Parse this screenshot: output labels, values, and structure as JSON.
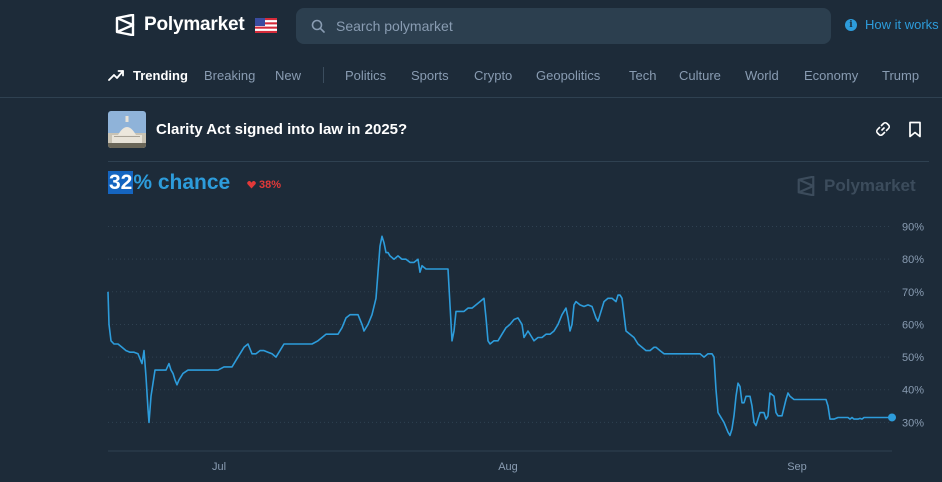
{
  "header": {
    "logo_text": "Polymarket",
    "flag_icon": "us-flag-icon",
    "search_placeholder": "Search polymarket",
    "how_it_works": "How it works",
    "accent": "#2d9cdb"
  },
  "nav": {
    "items": [
      {
        "label": "Trending",
        "active": true
      },
      {
        "label": "Breaking"
      },
      {
        "label": "New"
      },
      {
        "label": "Politics"
      },
      {
        "label": "Sports"
      },
      {
        "label": "Crypto"
      },
      {
        "label": "Geopolitics"
      },
      {
        "label": "Tech"
      },
      {
        "label": "Culture"
      },
      {
        "label": "World"
      },
      {
        "label": "Economy"
      },
      {
        "label": "Trump"
      }
    ]
  },
  "market": {
    "title": "Clarity Act signed into law in 2025?",
    "chance_value": "32",
    "chance_suffix": "% chance",
    "change": "38%",
    "change_direction": "down",
    "change_color": "#e23939",
    "watermark": "Polymarket"
  },
  "chart_data": {
    "type": "line",
    "series": [
      {
        "color": "#2d9cdb",
        "points": [
          [
            0,
            70
          ],
          [
            1,
            60
          ],
          [
            3,
            55
          ],
          [
            6,
            54
          ],
          [
            10,
            54
          ],
          [
            14,
            53
          ],
          [
            18,
            52
          ],
          [
            22,
            51.5
          ],
          [
            26,
            51.5
          ],
          [
            30,
            51
          ],
          [
            34,
            48
          ],
          [
            36,
            52
          ],
          [
            38,
            44
          ],
          [
            40,
            34
          ],
          [
            41,
            30
          ],
          [
            43,
            38
          ],
          [
            47,
            46
          ],
          [
            51,
            46
          ],
          [
            54,
            46
          ],
          [
            58,
            46
          ],
          [
            61,
            48
          ],
          [
            63,
            46
          ],
          [
            65,
            45
          ],
          [
            67,
            43
          ],
          [
            69,
            41.5
          ],
          [
            71,
            43
          ],
          [
            75,
            45
          ],
          [
            80,
            46
          ],
          [
            86,
            46
          ],
          [
            92,
            46
          ],
          [
            98,
            46
          ],
          [
            104,
            46
          ],
          [
            110,
            46
          ],
          [
            116,
            47
          ],
          [
            120,
            47
          ],
          [
            124,
            47
          ],
          [
            128,
            49
          ],
          [
            132,
            51
          ],
          [
            136,
            53
          ],
          [
            140,
            54
          ],
          [
            144,
            51
          ],
          [
            148,
            51
          ],
          [
            152,
            52
          ],
          [
            156,
            52
          ],
          [
            160,
            51.5
          ],
          [
            164,
            51
          ],
          [
            168,
            50
          ],
          [
            172,
            52
          ],
          [
            176,
            54
          ],
          [
            180,
            54
          ],
          [
            186,
            54
          ],
          [
            192,
            54
          ],
          [
            198,
            54
          ],
          [
            204,
            54
          ],
          [
            210,
            55
          ],
          [
            214,
            56
          ],
          [
            218,
            57
          ],
          [
            222,
            57
          ],
          [
            226,
            57
          ],
          [
            230,
            57
          ],
          [
            234,
            59
          ],
          [
            238,
            62
          ],
          [
            242,
            63
          ],
          [
            246,
            63
          ],
          [
            250,
            63
          ],
          [
            254,
            60
          ],
          [
            256,
            58
          ],
          [
            260,
            60
          ],
          [
            264,
            63
          ],
          [
            268,
            68
          ],
          [
            270,
            76
          ],
          [
            272,
            84
          ],
          [
            274,
            87
          ],
          [
            276,
            85
          ],
          [
            278,
            82
          ],
          [
            280,
            82
          ],
          [
            282,
            81
          ],
          [
            286,
            80
          ],
          [
            290,
            81
          ],
          [
            294,
            80
          ],
          [
            298,
            80
          ],
          [
            302,
            79
          ],
          [
            306,
            79
          ],
          [
            310,
            80
          ],
          [
            312,
            76
          ],
          [
            314,
            78
          ],
          [
            318,
            77
          ],
          [
            324,
            77
          ],
          [
            330,
            77
          ],
          [
            336,
            77
          ],
          [
            340,
            77
          ],
          [
            342,
            66
          ],
          [
            344,
            55
          ],
          [
            346,
            58
          ],
          [
            348,
            64
          ],
          [
            352,
            64
          ],
          [
            356,
            64
          ],
          [
            360,
            65
          ],
          [
            364,
            65
          ],
          [
            368,
            66
          ],
          [
            372,
            67
          ],
          [
            376,
            68
          ],
          [
            378,
            62
          ],
          [
            380,
            55
          ],
          [
            382,
            54
          ],
          [
            386,
            55
          ],
          [
            390,
            55
          ],
          [
            394,
            57
          ],
          [
            398,
            59
          ],
          [
            402,
            60
          ],
          [
            406,
            61.5
          ],
          [
            410,
            62
          ],
          [
            414,
            60
          ],
          [
            416,
            56
          ],
          [
            420,
            58
          ],
          [
            424,
            56
          ],
          [
            426,
            55
          ],
          [
            430,
            56
          ],
          [
            434,
            56
          ],
          [
            438,
            57
          ],
          [
            442,
            57
          ],
          [
            446,
            58
          ],
          [
            450,
            60
          ],
          [
            454,
            63
          ],
          [
            458,
            65
          ],
          [
            460,
            62
          ],
          [
            462,
            58
          ],
          [
            464,
            60
          ],
          [
            466,
            66
          ],
          [
            468,
            67
          ],
          [
            472,
            66
          ],
          [
            476,
            65.5
          ],
          [
            480,
            66
          ],
          [
            484,
            65.5
          ],
          [
            488,
            62
          ],
          [
            490,
            61
          ],
          [
            492,
            63
          ],
          [
            496,
            67
          ],
          [
            500,
            68
          ],
          [
            504,
            68
          ],
          [
            508,
            67
          ],
          [
            510,
            69
          ],
          [
            512,
            69
          ],
          [
            514,
            68
          ],
          [
            518,
            58
          ],
          [
            522,
            57
          ],
          [
            526,
            56
          ],
          [
            530,
            54
          ],
          [
            534,
            53
          ],
          [
            538,
            52
          ],
          [
            542,
            52
          ],
          [
            546,
            53
          ],
          [
            548,
            53
          ],
          [
            552,
            52
          ],
          [
            556,
            51
          ],
          [
            560,
            51
          ],
          [
            564,
            51
          ],
          [
            568,
            51
          ],
          [
            572,
            51
          ],
          [
            576,
            51
          ],
          [
            580,
            51
          ],
          [
            584,
            51
          ],
          [
            588,
            51
          ],
          [
            592,
            51
          ],
          [
            596,
            50
          ],
          [
            600,
            51
          ],
          [
            604,
            51
          ],
          [
            606,
            50
          ],
          [
            608,
            40
          ],
          [
            610,
            33
          ],
          [
            612,
            32
          ],
          [
            616,
            30
          ],
          [
            620,
            27
          ],
          [
            622,
            26
          ],
          [
            624,
            28
          ],
          [
            626,
            32
          ],
          [
            628,
            38
          ],
          [
            630,
            42
          ],
          [
            632,
            41
          ],
          [
            634,
            36
          ],
          [
            636,
            36
          ],
          [
            638,
            38
          ],
          [
            642,
            38
          ],
          [
            644,
            35
          ],
          [
            646,
            30
          ],
          [
            648,
            29
          ],
          [
            652,
            33
          ],
          [
            656,
            33
          ],
          [
            658,
            31
          ],
          [
            660,
            32
          ],
          [
            662,
            39
          ],
          [
            666,
            38
          ],
          [
            668,
            33
          ],
          [
            670,
            32
          ],
          [
            674,
            32
          ],
          [
            678,
            37
          ],
          [
            680,
            39
          ],
          [
            682,
            38
          ],
          [
            686,
            37
          ],
          [
            690,
            37
          ],
          [
            694,
            37
          ],
          [
            698,
            37
          ],
          [
            702,
            37
          ],
          [
            706,
            37
          ],
          [
            710,
            37
          ],
          [
            714,
            37
          ],
          [
            718,
            37
          ],
          [
            720,
            35
          ],
          [
            722,
            31
          ],
          [
            726,
            31
          ],
          [
            730,
            31.5
          ],
          [
            734,
            31.5
          ],
          [
            738,
            31.5
          ],
          [
            740,
            31.5
          ],
          [
            742,
            31
          ],
          [
            744,
            31.5
          ],
          [
            746,
            31
          ],
          [
            748,
            31
          ],
          [
            750,
            31
          ],
          [
            752,
            31.2
          ],
          [
            754,
            31
          ],
          [
            756,
            31.5
          ],
          [
            758,
            31.5
          ],
          [
            760,
            31.5
          ],
          [
            762,
            31.5
          ],
          [
            764,
            31.5
          ],
          [
            766,
            31.5
          ],
          [
            768,
            31.5
          ],
          [
            770,
            31.5
          ],
          [
            772,
            31.5
          ],
          [
            774,
            31.5
          ],
          [
            776,
            31.5
          ],
          [
            778,
            31.5
          ],
          [
            780,
            31.5
          ],
          [
            782,
            31.5
          ],
          [
            784,
            31.5
          ]
        ]
      }
    ],
    "x_ticks": [
      "Jul",
      "Aug",
      "Sep"
    ],
    "x_tick_positions": [
      111,
      400,
      689
    ],
    "x_range": [
      0,
      784
    ],
    "y_ticks": [
      "90%",
      "80%",
      "70%",
      "60%",
      "50%",
      "40%",
      "30%"
    ],
    "y_tick_values": [
      90,
      80,
      70,
      60,
      50,
      40,
      30
    ],
    "ylim": [
      20,
      92
    ],
    "grid": true
  }
}
